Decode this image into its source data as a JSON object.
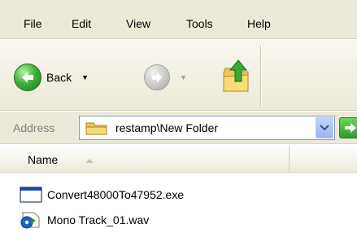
{
  "menu": {
    "items": [
      "File",
      "Edit",
      "View",
      "Tools",
      "Help"
    ]
  },
  "toolbar": {
    "back_label": "Back"
  },
  "address": {
    "label": "Address",
    "path": "restamp\\New Folder"
  },
  "list": {
    "column_name": "Name",
    "files": [
      {
        "name": "Convert48000To47952.exe",
        "icon": "exe-icon"
      },
      {
        "name": "Mono Track_01.wav",
        "icon": "wav-icon"
      }
    ]
  }
}
